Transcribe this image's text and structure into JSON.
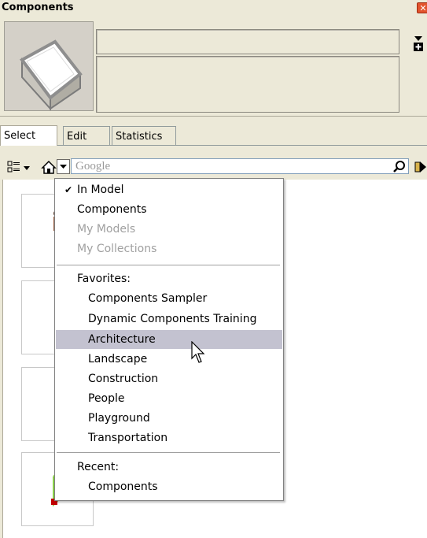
{
  "window": {
    "title": "Components",
    "close_glyph": "✕"
  },
  "tabs": [
    {
      "label": "Select",
      "active": true
    },
    {
      "label": "Edit",
      "active": false
    },
    {
      "label": "Statistics",
      "active": false
    }
  ],
  "search": {
    "placeholder": "Google"
  },
  "menu": {
    "items": [
      {
        "label": "In Model",
        "checked": true,
        "disabled": false
      },
      {
        "label": "Components",
        "disabled": false
      },
      {
        "label": "My Models",
        "disabled": true
      },
      {
        "label": "My Collections",
        "disabled": true
      }
    ],
    "favorites_header": "Favorites:",
    "favorites": [
      "Components Sampler",
      "Dynamic Components Training",
      "Architecture",
      "Landscape",
      "Construction",
      "People",
      "Playground",
      "Transportation"
    ],
    "highlighted": "Architecture",
    "recent_header": "Recent:",
    "recent": [
      "Components"
    ]
  },
  "icons": {
    "check": "✔"
  },
  "colors": {
    "panel_bg": "#ece9d8",
    "menu_highlight": "#c3c2d0",
    "close_button": "#e2532d"
  }
}
